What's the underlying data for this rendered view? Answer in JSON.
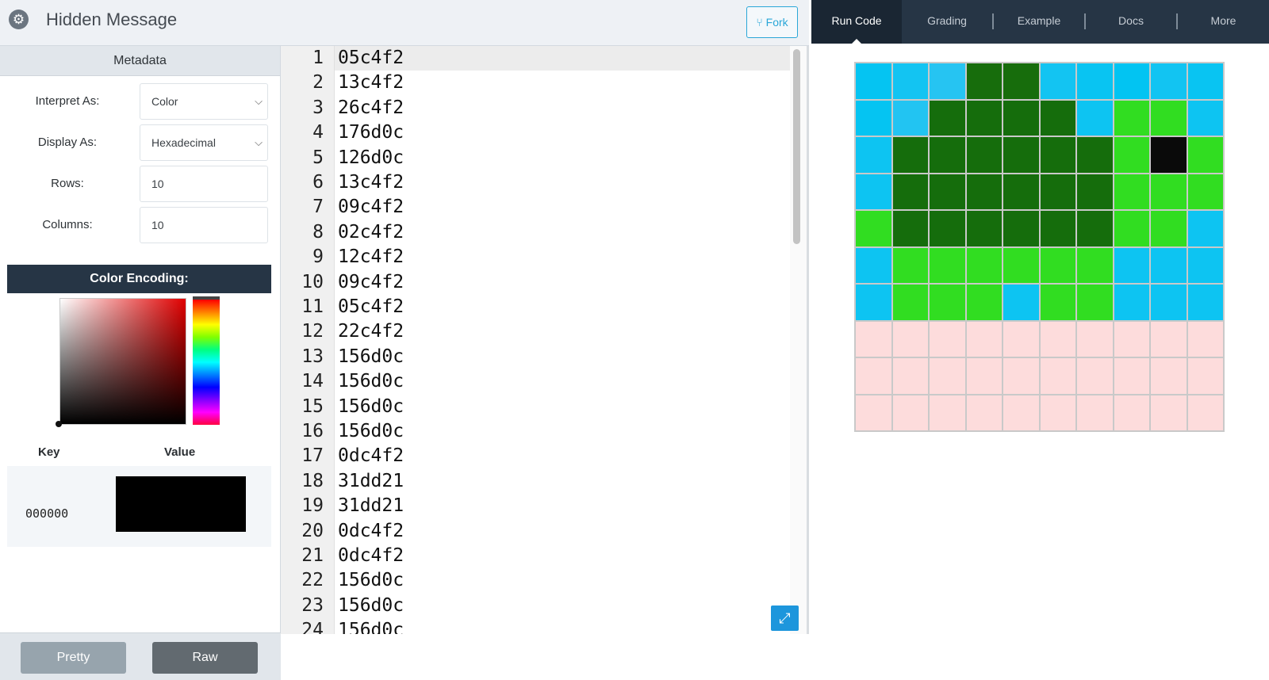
{
  "header": {
    "settings_icon": "gear-icon",
    "title": "Hidden Message",
    "fork_icon": "fork-icon",
    "fork_label": "Fork"
  },
  "metadata": {
    "heading": "Metadata",
    "fields": [
      {
        "label": "Interpret As:",
        "value": "Color",
        "type": "select"
      },
      {
        "label": "Display As:",
        "value": "Hexadecimal",
        "type": "select"
      },
      {
        "label": "Rows:",
        "value": "10",
        "type": "input"
      },
      {
        "label": "Columns:",
        "value": "10",
        "type": "input"
      }
    ],
    "color_encoding": {
      "heading": "Color Encoding:",
      "key_header": "Key",
      "value_header": "Value",
      "key": "000000",
      "swatch_color": "#000000"
    },
    "buttons": {
      "pretty": "Pretty",
      "raw": "Raw"
    }
  },
  "editor": {
    "lines": [
      "05c4f2",
      "13c4f2",
      "26c4f2",
      "176d0c",
      "126d0c",
      "13c4f2",
      "09c4f2",
      "02c4f2",
      "12c4f2",
      "09c4f2",
      "05c4f2",
      "22c4f2",
      "156d0c",
      "156d0c",
      "156d0c",
      "156d0c",
      "0dc4f2",
      "31dd21",
      "31dd21",
      "0dc4f2",
      "0dc4f2",
      "156d0c",
      "156d0c",
      "156d0c"
    ],
    "expand_icon": "expand-icon"
  },
  "tabs": [
    {
      "label": "Run Code",
      "active": true
    },
    {
      "label": "Grading",
      "active": false
    },
    {
      "label": "Example",
      "active": false
    },
    {
      "label": "Docs",
      "active": false
    },
    {
      "label": "More",
      "active": false
    }
  ],
  "output": {
    "rows": 10,
    "columns": 10,
    "cells": [
      [
        "#05c4f2",
        "#13c4f2",
        "#26c4f2",
        "#176d0c",
        "#176d0c",
        "#13c4f2",
        "#09c4f2",
        "#02c4f2",
        "#12c4f2",
        "#09c4f2"
      ],
      [
        "#05c4f2",
        "#22c4f2",
        "#156d0c",
        "#156d0c",
        "#156d0c",
        "#156d0c",
        "#0dc4f2",
        "#31dd21",
        "#31dd21",
        "#0dc4f2"
      ],
      [
        "#0dc4f2",
        "#156d0c",
        "#156d0c",
        "#156d0c",
        "#156d0c",
        "#156d0c",
        "#156d0c",
        "#31dd21",
        "#0a0a0a",
        "#31dd21"
      ],
      [
        "#0dc4f2",
        "#156d0c",
        "#156d0c",
        "#156d0c",
        "#156d0c",
        "#156d0c",
        "#156d0c",
        "#31dd21",
        "#31dd21",
        "#31dd21"
      ],
      [
        "#31dd21",
        "#156d0c",
        "#156d0c",
        "#156d0c",
        "#156d0c",
        "#156d0c",
        "#156d0c",
        "#31dd21",
        "#31dd21",
        "#0dc4f2"
      ],
      [
        "#0dc4f2",
        "#31dd21",
        "#31dd21",
        "#31dd21",
        "#31dd21",
        "#31dd21",
        "#31dd21",
        "#0dc4f2",
        "#0dc4f2",
        "#0dc4f2"
      ],
      [
        "#0dc4f2",
        "#31dd21",
        "#31dd21",
        "#31dd21",
        "#0dc4f2",
        "#31dd21",
        "#31dd21",
        "#0dc4f2",
        "#0dc4f2",
        "#0dc4f2"
      ],
      [
        "#fddcdc",
        "#fddcdc",
        "#fddcdc",
        "#fddcdc",
        "#fddcdc",
        "#fddcdc",
        "#fddcdc",
        "#fddcdc",
        "#fddcdc",
        "#fddcdc"
      ],
      [
        "#fddcdc",
        "#fddcdc",
        "#fddcdc",
        "#fddcdc",
        "#fddcdc",
        "#fddcdc",
        "#fddcdc",
        "#fddcdc",
        "#fddcdc",
        "#fddcdc"
      ],
      [
        "#fddcdc",
        "#fddcdc",
        "#fddcdc",
        "#fddcdc",
        "#fddcdc",
        "#fddcdc",
        "#fddcdc",
        "#fddcdc",
        "#fddcdc",
        "#fddcdc"
      ]
    ]
  }
}
